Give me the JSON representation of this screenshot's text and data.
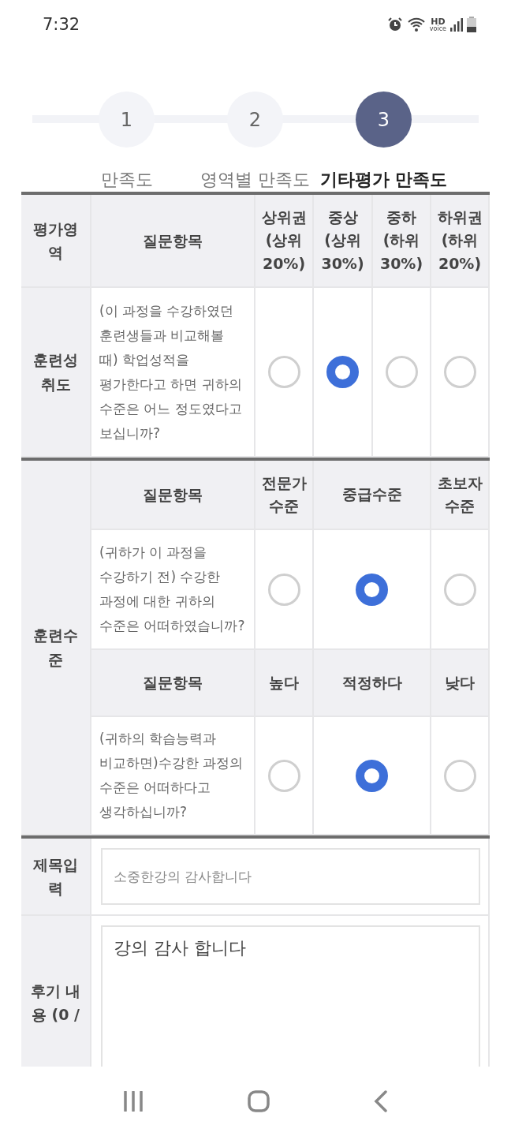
{
  "status_bar": {
    "time": "7:32",
    "hd_badge": {
      "top": "HD",
      "bottom": "voice"
    }
  },
  "steps": [
    {
      "number": "1",
      "label": "만족도",
      "selected": false
    },
    {
      "number": "2",
      "label": "영역별 만족도",
      "selected": false
    },
    {
      "number": "3",
      "label": "기타평가 만족도",
      "selected": true
    }
  ],
  "achievement": {
    "area_header": "평가영역",
    "question_header": "질문항목",
    "options": [
      "상위권 (상위 20%)",
      "중상 (상위 30%)",
      "중하 (하위 30%)",
      "하위권 (하위 20%)"
    ],
    "area": "훈련성취도",
    "question": "(이 과정을 수강하였던 훈련생들과 비교해볼 때) 학업성적을 평가한다고 하면 귀하의 수준은 어느 정도였다고 보십니까?",
    "answers": [
      {
        "selected": false
      },
      {
        "selected": true
      },
      {
        "selected": false
      },
      {
        "selected": false
      }
    ]
  },
  "level": {
    "area": "훈련수준",
    "groups": [
      {
        "question_header": "질문항목",
        "options": [
          "전문가 수준",
          "중급수준",
          "초보자 수준"
        ],
        "question": "(귀하가 이 과정을 수강하기 전) 수강한 과정에 대한 귀하의 수준은 어떠하였습니까?",
        "answers": [
          {
            "selected": false
          },
          {
            "selected": true
          },
          {
            "selected": false
          }
        ]
      },
      {
        "question_header": "질문항목",
        "options": [
          "높다",
          "적정하다",
          "낮다"
        ],
        "question": "(귀하의 학습능력과 비교하면)수강한 과정의 수준은 어떠하다고 생각하십니까?",
        "answers": [
          {
            "selected": false
          },
          {
            "selected": true
          },
          {
            "selected": false
          }
        ]
      }
    ]
  },
  "title_input": {
    "label": "제목입력",
    "placeholder": "소중한강의 감사합니다"
  },
  "review": {
    "label": "후기 내용 (0 /",
    "value": "강의 감사 합니다"
  }
}
